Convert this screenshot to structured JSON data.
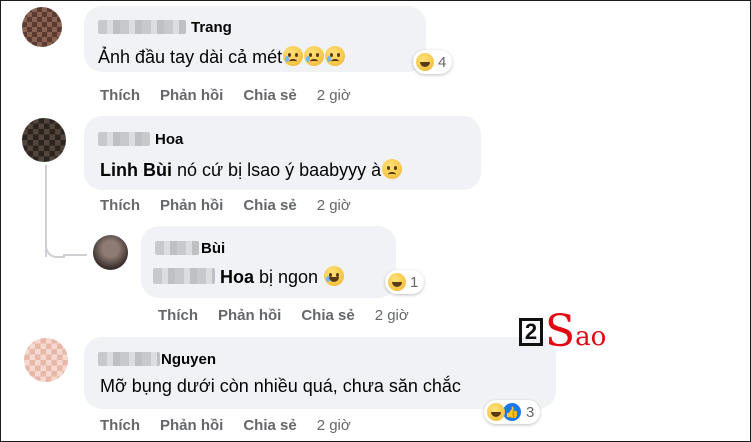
{
  "comments": [
    {
      "name": "Trang",
      "text": "Ảnh đầu tay dài cả mét",
      "reaction_count": "4",
      "actions": [
        "Thích",
        "Phản hồi",
        "Chia sẻ"
      ],
      "time": "2 giờ"
    },
    {
      "name": "Hoa",
      "mention": "Linh Bùi",
      "text": " nó cứ bị lsao ý baabyyy à",
      "actions": [
        "Thích",
        "Phản hồi",
        "Chia sẻ"
      ],
      "time": "2 giờ"
    },
    {
      "name": "Bùi",
      "mention": "Hoa",
      "text": " bị ngon",
      "reaction_count": "1",
      "actions": [
        "Thích",
        "Phản hồi",
        "Chia sẻ"
      ],
      "time": "2 giờ"
    },
    {
      "name": "Nguyen",
      "text": "Mỡ bụng dưới còn nhiều quá, chưa săn chắc",
      "reaction_count": "3",
      "actions": [
        "Thích",
        "Phản hồi",
        "Chia sẻ"
      ],
      "time": "2 giờ"
    }
  ],
  "watermark": {
    "digit": "2",
    "letter": "S",
    "rest": "ao"
  },
  "colors": {
    "bubble": "#f0f2f5",
    "meta": "#65676b",
    "brand_red": "#e30613"
  }
}
